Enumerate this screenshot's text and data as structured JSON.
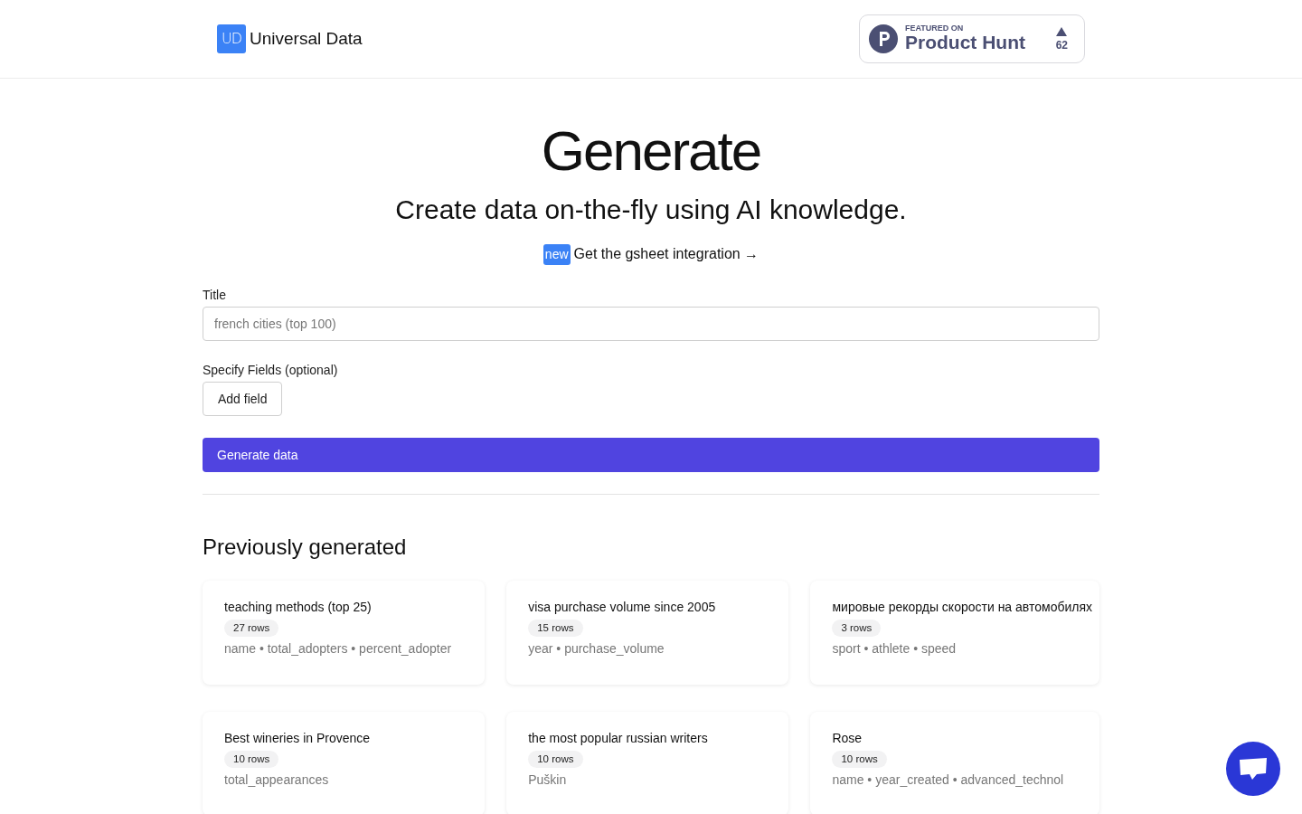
{
  "header": {
    "logo": {
      "mark": "UD",
      "name": "Universal Data"
    },
    "product_hunt": {
      "eyebrow": "FEATURED ON",
      "name": "Product Hunt",
      "upvotes": "62"
    }
  },
  "hero": {
    "title": "Generate",
    "subtitle": "Create data on-the-fly using AI knowledge.",
    "promo": {
      "badge": "new",
      "link": "Get the gsheet integration →"
    }
  },
  "form": {
    "title_field": {
      "label": "Title",
      "placeholder": "french cities (top 100)"
    },
    "fields_label": "Specify Fields (optional)",
    "add_field_button": "Add field",
    "submit_button": "Generate data"
  },
  "previous": {
    "heading": "Previously generated",
    "items": [
      {
        "title": "teaching methods (top 25)",
        "rows": "27 rows",
        "fields": "name • total_adopters • percent_adopter"
      },
      {
        "title": "visa purchase volume since 2005",
        "rows": "15 rows",
        "fields": "year • purchase_volume"
      },
      {
        "title": "мировые рекорды скорости на автомобилях",
        "rows": "3 rows",
        "fields": "sport • athlete • speed"
      },
      {
        "title": "Best wineries in Provence",
        "rows": "10 rows",
        "fields": "total_appearances"
      },
      {
        "title": "the most popular russian writers",
        "rows": "10 rows",
        "fields": "Puškin"
      },
      {
        "title": "Rose",
        "rows": "10 rows",
        "fields": "name • year_created • advanced_technol"
      }
    ]
  }
}
